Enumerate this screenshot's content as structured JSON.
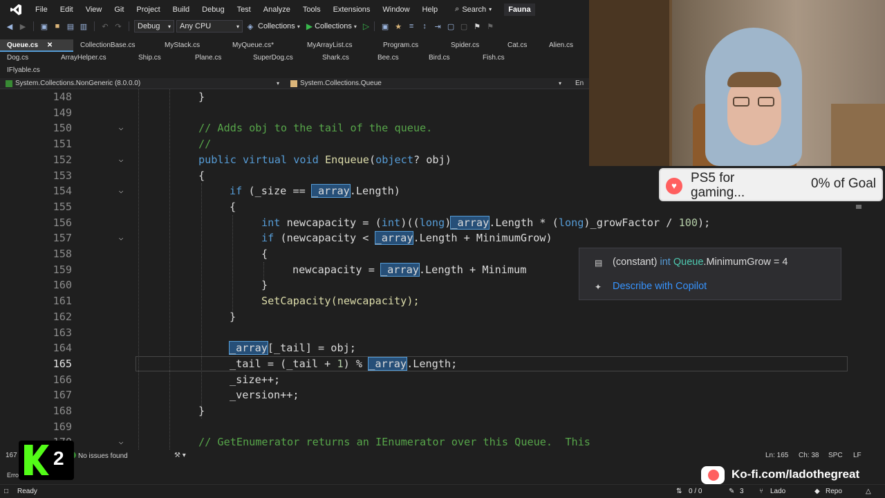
{
  "menu": {
    "items": [
      "File",
      "Edit",
      "View",
      "Git",
      "Project",
      "Build",
      "Debug",
      "Test",
      "Analyze",
      "Tools",
      "Extensions",
      "Window",
      "Help"
    ],
    "search_label": "Search",
    "profile": "Fauna"
  },
  "toolbar": {
    "config": "Debug",
    "platform": "Any CPU",
    "startup_project": "Collections",
    "run_label": "Collections"
  },
  "tabs": {
    "row1": [
      "Queue.cs",
      "CollectionBase.cs",
      "MyStack.cs",
      "MyQueue.cs*",
      "MyArrayList.cs",
      "Program.cs",
      "Spider.cs",
      "Cat.cs",
      "Alien.cs"
    ],
    "row2": [
      "Dog.cs",
      "ArrayHelper.cs",
      "Ship.cs",
      "Plane.cs",
      "SuperDog.cs",
      "Shark.cs",
      "Bee.cs",
      "Bird.cs",
      "Fish.cs"
    ],
    "row3": [
      "IFlyable.cs"
    ]
  },
  "navbar": {
    "project": "System.Collections.NonGeneric (8.0.0.0)",
    "type": "System.Collections.Queue",
    "member": "En"
  },
  "code": {
    "lines": [
      {
        "n": "148",
        "t": "}"
      },
      {
        "n": "149",
        "t": ""
      },
      {
        "n": "150",
        "t": "// Adds obj to the tail of the queue."
      },
      {
        "n": "151",
        "t": "//"
      },
      {
        "n": "152",
        "t": "public virtual void Enqueue(object? obj)"
      },
      {
        "n": "153",
        "t": "{"
      },
      {
        "n": "154",
        "t": "if (_size == _array.Length)"
      },
      {
        "n": "155",
        "t": "{"
      },
      {
        "n": "156",
        "t": "int newcapacity = (int)((long)_array.Length * (long)_growFactor / 100);"
      },
      {
        "n": "157",
        "t": "if (newcapacity < _array.Length + MinimumGrow)"
      },
      {
        "n": "158",
        "t": "{"
      },
      {
        "n": "159",
        "t": "newcapacity = _array.Length + Minimum"
      },
      {
        "n": "160",
        "t": "}"
      },
      {
        "n": "161",
        "t": "SetCapacity(newcapacity);"
      },
      {
        "n": "162",
        "t": "}"
      },
      {
        "n": "163",
        "t": ""
      },
      {
        "n": "164",
        "t": "_array[_tail] = obj;"
      },
      {
        "n": "165",
        "t": "_tail = (_tail + 1) % _array.Length;"
      },
      {
        "n": "166",
        "t": "_size++;"
      },
      {
        "n": "167",
        "t": "_version++;"
      },
      {
        "n": "168",
        "t": "}"
      },
      {
        "n": "169",
        "t": ""
      },
      {
        "n": "170",
        "t": "// GetEnumerator returns an IEnumerator over this Queue.  This"
      }
    ]
  },
  "quickinfo": {
    "prefix": "(constant)",
    "type_kw": "int",
    "class": "Queue",
    "member": ".MinimumGrow = 4",
    "copilot": "Describe with Copilot"
  },
  "edit_status": {
    "zoom": "167",
    "issues": "No issues found",
    "ln": "Ln: 165",
    "ch": "Ch: 38",
    "spc": "SPC",
    "lf": "LF"
  },
  "output_label": "Erro",
  "statusbar": {
    "ready": "Ready",
    "git_changes": "0 / 0",
    "pencil_count": "3",
    "user": "Lado",
    "repo": "Repo"
  },
  "overlay": {
    "goal_title": "PS5 for gaming...",
    "goal_percent": "0% of Goal",
    "kofi": "Ko-fi.com/ladothegreat",
    "logo_number": "2"
  },
  "colors": {
    "background": "#1f1f1f",
    "keyword": "#569cd6",
    "comment": "#57a64a",
    "method": "#dcdcaa",
    "highlight": "#264f78",
    "accent": "#3794ff"
  }
}
